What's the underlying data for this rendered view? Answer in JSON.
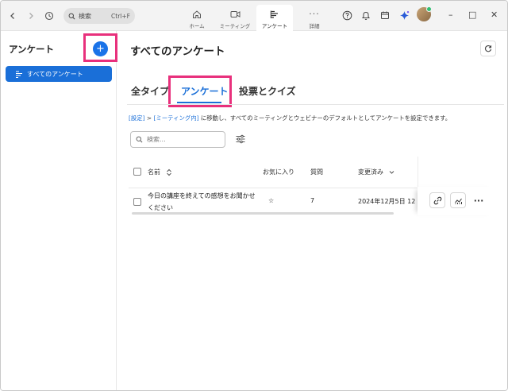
{
  "toolbar": {
    "search_placeholder": "検索",
    "search_shortcut": "Ctrl+F",
    "nav_tabs": [
      {
        "label": "ホーム",
        "icon": "home-icon"
      },
      {
        "label": "ミーティング",
        "icon": "video-icon"
      },
      {
        "label": "アンケート",
        "icon": "poll-icon",
        "active": true
      },
      {
        "label": "詳細",
        "icon": "more-icon"
      }
    ],
    "window_controls": {
      "minimize": "–",
      "maximize": "□",
      "close": "✕"
    }
  },
  "sidebar": {
    "title": "アンケート",
    "add_label": "+",
    "items": [
      {
        "label": "すべてのアンケート",
        "selected": true
      }
    ]
  },
  "main": {
    "title": "すべてのアンケート",
    "tabs": [
      {
        "label": "全タイプ"
      },
      {
        "label": "アンケート",
        "active": true
      },
      {
        "label": "投票とクイズ"
      }
    ],
    "info": {
      "link1": "[設定]",
      "sep": " > ",
      "link2": "[ミーティング内]",
      "text": " に移動し、すべてのミーティングとウェビナーのデフォルトとしてアンケートを設定できます。"
    },
    "search_placeholder": "検索...",
    "table": {
      "columns": [
        "名前",
        "お気に入り",
        "質問",
        "変更済み"
      ],
      "rows": [
        {
          "name": "今日の講座を終えての感想をお聞かせください",
          "favorite": "☆",
          "questions": "7",
          "modified": "2024年12月5日 12"
        }
      ]
    }
  },
  "colors": {
    "accent": "#1a6fd8",
    "highlight": "#e8307c",
    "topbar_bg": "#f3f3f3"
  }
}
